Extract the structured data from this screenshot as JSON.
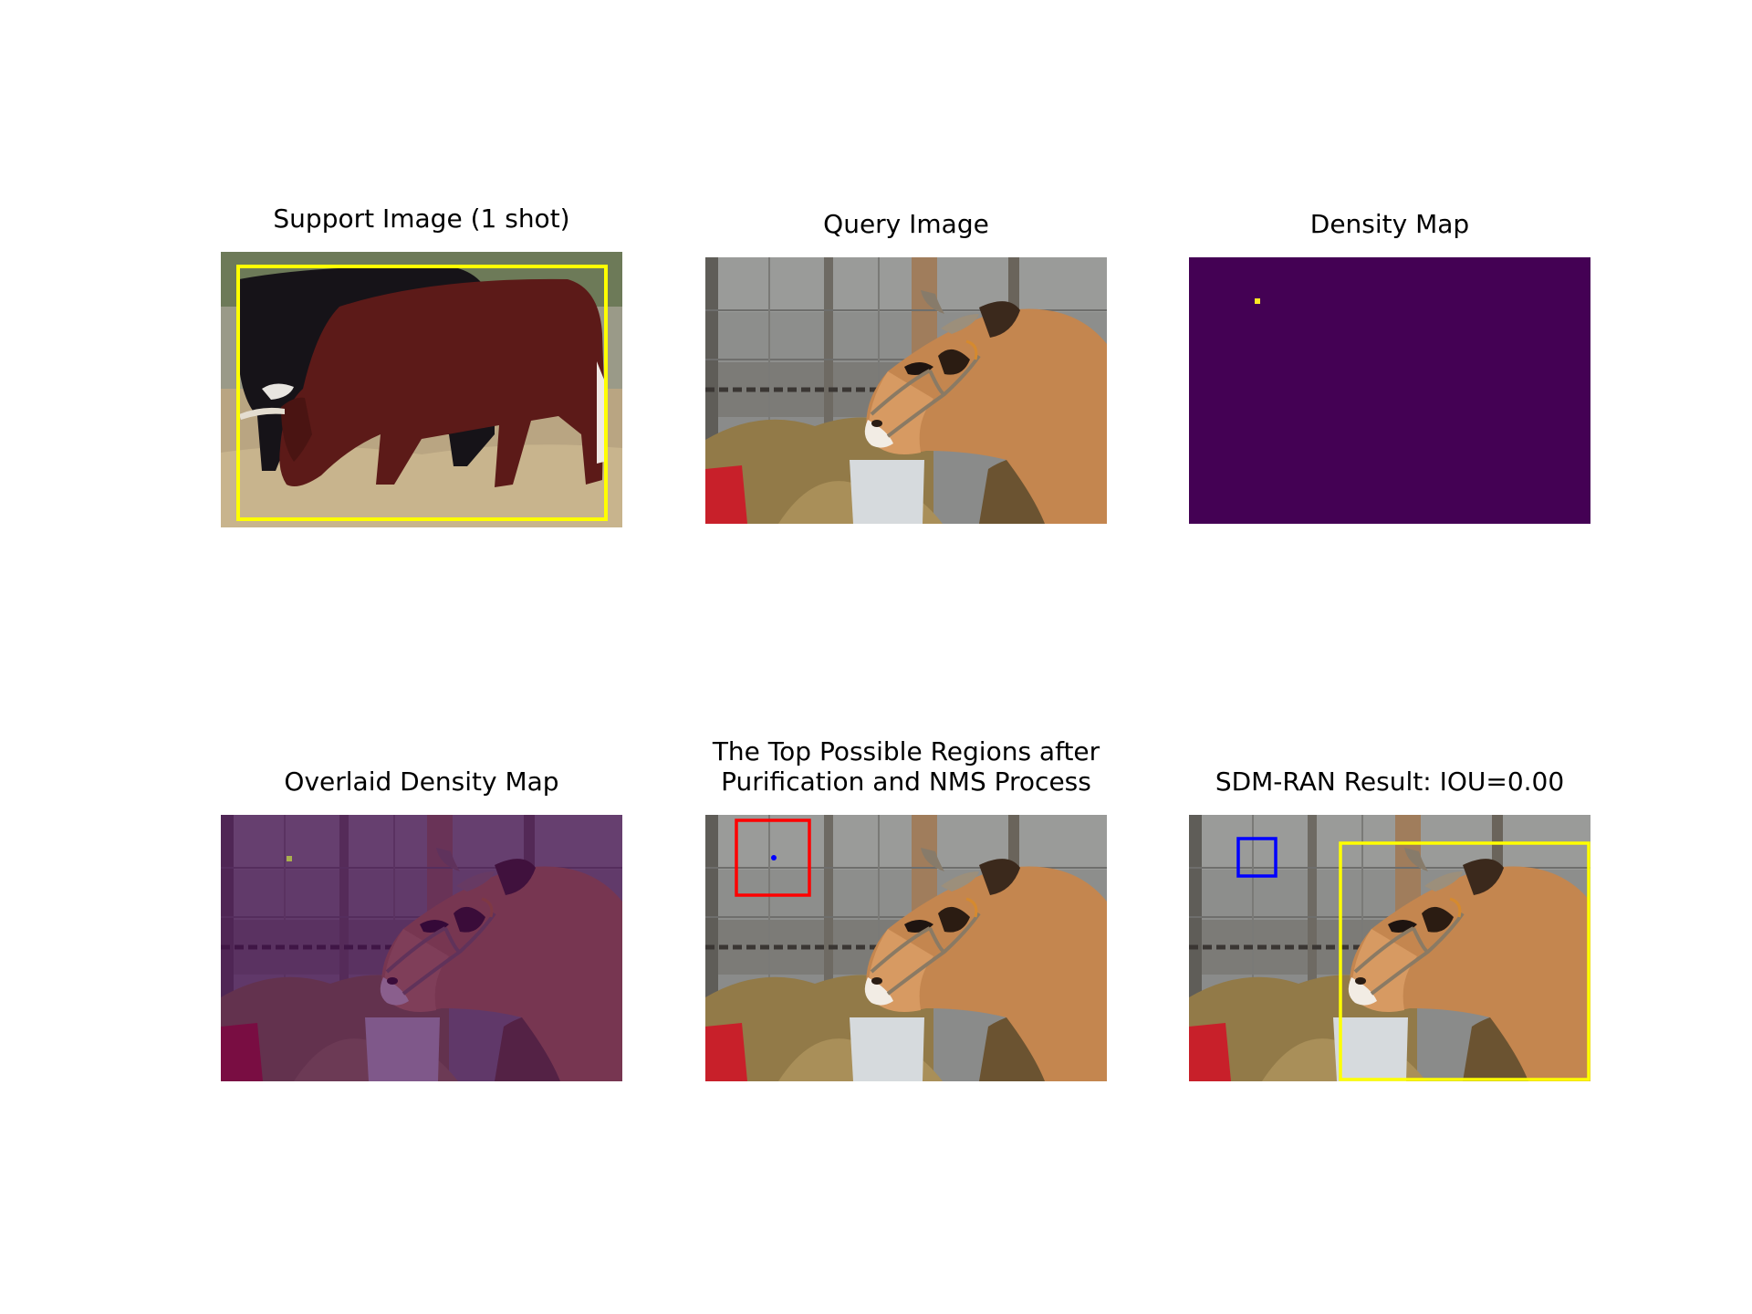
{
  "panels": {
    "support": {
      "title": "Support Image (1 shot)"
    },
    "query": {
      "title": "Query Image"
    },
    "density": {
      "title": "Density Map"
    },
    "overlaid": {
      "title": "Overlaid Density Map"
    },
    "regions": {
      "title_line1": "The Top Possible Regions after",
      "title_line2": "Purification and NMS Process"
    },
    "result": {
      "title": "SDM-RAN Result: IOU=0.00"
    }
  },
  "colors": {
    "exemplar_box": "#ffff00",
    "ground_truth_box": "#ffff00",
    "candidate_region_box": "#ff0000",
    "predicted_box": "#0000ff",
    "density_background": "#440154",
    "density_peak": "#fde725",
    "density_point": "#0000ff"
  }
}
